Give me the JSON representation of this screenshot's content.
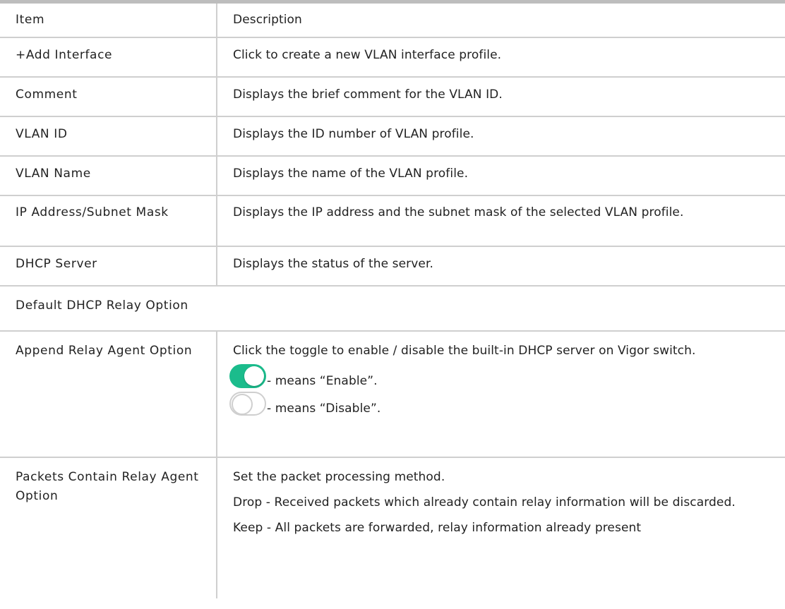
{
  "table": {
    "header": {
      "item": "Item",
      "description": "Description"
    },
    "rows": [
      {
        "item": "+Add Interface",
        "desc": "Click to create a new VLAN interface profile."
      },
      {
        "item": "Comment",
        "desc": "Displays the brief comment for the VLAN ID."
      },
      {
        "item": "VLAN ID",
        "desc": "Displays the ID number of VLAN profile."
      },
      {
        "item": "VLAN Name",
        "desc": "Displays the name of the VLAN profile."
      },
      {
        "item": "IP Address/Subnet Mask",
        "desc": "Displays the IP address and the subnet mask of the selected VLAN profile."
      },
      {
        "item": "DHCP Server",
        "desc": "Displays the status of the server."
      }
    ],
    "section": "Default DHCP Relay Option",
    "append_row": {
      "item": "Append Relay Agent Option",
      "desc": "Click the toggle to enable / disable the built-in DHCP server on Vigor switch.",
      "enable_text": "- means “Enable”.",
      "disable_text": "- means “Disable”."
    },
    "packets_row": {
      "item": "Packets Contain Relay Agent Option",
      "desc1": "Set the packet processing method.",
      "desc2": "Drop - Received packets which already contain relay information will be discarded.",
      "desc3": "Keep - All packets are forwarded, relay information already present"
    }
  },
  "colors": {
    "toggle_on": "#1bbc8c",
    "border": "#cfcfcf",
    "top_bar": "#bdbdbd"
  }
}
